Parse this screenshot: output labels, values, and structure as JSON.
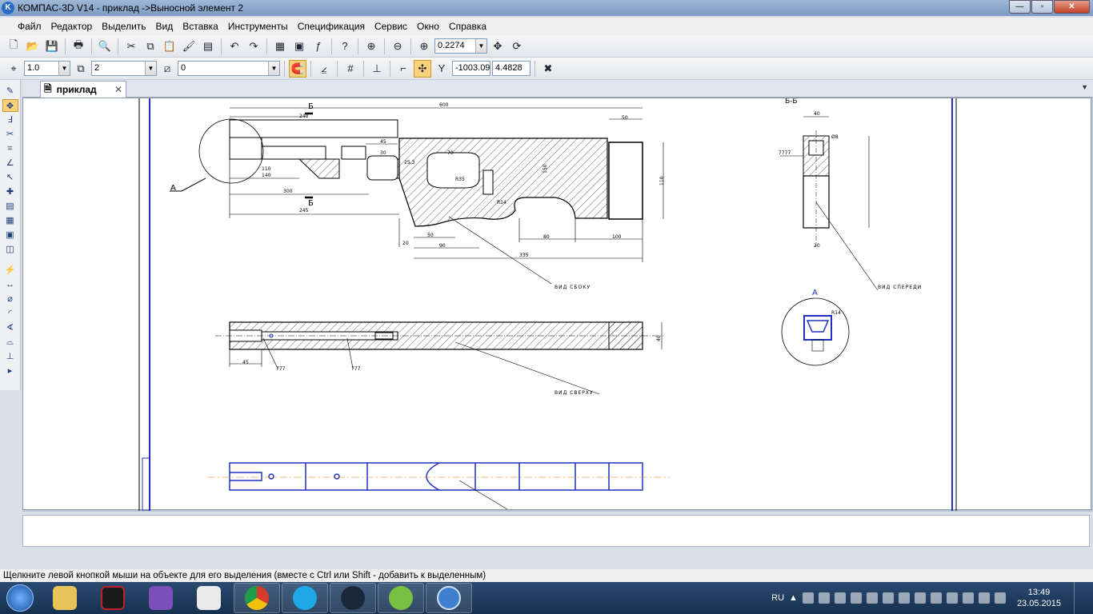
{
  "window": {
    "title": "КОМПАС-3D V14 - приклад ->Выносной элемент 2",
    "icon": "kompas-app-icon"
  },
  "window_controls": {
    "minimize": "—",
    "maximize": "▫",
    "close": "✕"
  },
  "menu": [
    "Файл",
    "Редактор",
    "Выделить",
    "Вид",
    "Вставка",
    "Инструменты",
    "Спецификация",
    "Сервис",
    "Окно",
    "Справка"
  ],
  "toolbar1": {
    "zoom_value": "0.2274"
  },
  "toolbar2": {
    "step_value": "1.0",
    "layer_value": "2",
    "state_value": "0",
    "coord_x": "-1003.09",
    "coord_y": "4.4828"
  },
  "document": {
    "tab_label": "приклад",
    "tab_close": "✕"
  },
  "drawing": {
    "section_label": "Б-Б",
    "labels": {
      "view_side": "ВИД СБОКУ",
      "view_front": "ВИД СПЕРЕДИ",
      "view_top": "ВИД СВЕРХУ",
      "callout_a": "А",
      "detail_a": "А",
      "cut_b_top": "Б",
      "cut_b_bottom": "Б"
    },
    "dims_side": [
      "600",
      "240",
      "50",
      "45",
      "30",
      "70",
      "140",
      "110",
      "300",
      "245",
      "20",
      "50",
      "90",
      "335",
      "80",
      "100",
      "R35",
      "R14",
      "150",
      "110",
      "25,3"
    ],
    "dims_front": [
      "40",
      "7777",
      "Ø8",
      "20"
    ],
    "dims_top": [
      "45",
      "777",
      "777",
      "40"
    ],
    "dims_detail": [
      "R14"
    ]
  },
  "status": {
    "hint": "Щелкните левой кнопкой мыши на объекте для его выделения (вместе с Ctrl или Shift - добавить к выделенным)"
  },
  "taskbar": {
    "apps": [
      "explorer",
      "red-game-app",
      "visual-studio",
      "paint-app",
      "chrome",
      "skype",
      "steam",
      "utorrent",
      "kompas"
    ],
    "language": "RU",
    "time": "13:49",
    "date": "23.05.2015"
  }
}
